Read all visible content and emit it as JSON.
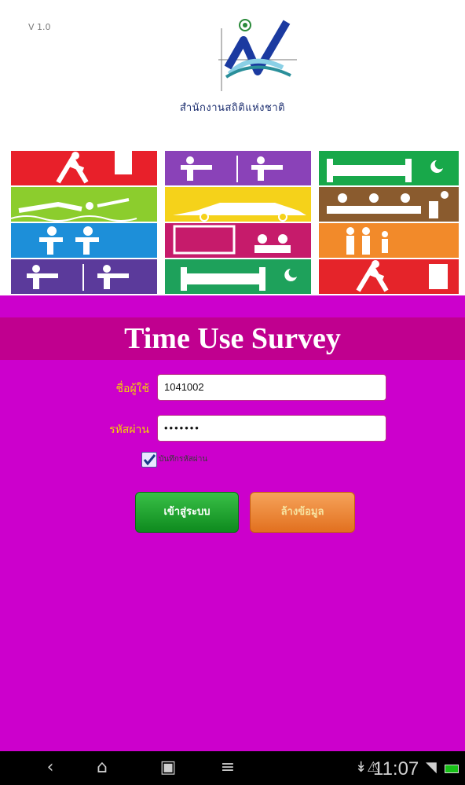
{
  "header": {
    "version": "V 1.0",
    "organization": "สำนักงานสถิติแห่งชาติ"
  },
  "colors": {
    "background_main": "#cc00cc",
    "title_bar": "#c0008f",
    "label_text": "#f4d400",
    "login_button": "#1aa02c",
    "clear_button": "#ef8a35"
  },
  "tiles": [
    {
      "name": "sports-walk-tile",
      "color": "#e8202a",
      "icon": "walking-figure-icon"
    },
    {
      "name": "work-desk-tile",
      "color": "#8a42b8",
      "icon": "desk-worker-icon"
    },
    {
      "name": "sleep-tile",
      "color": "#18a84a",
      "icon": "bed-icon"
    },
    {
      "name": "swimming-tile",
      "color": "#8ccd2d",
      "icon": "swimming-icon"
    },
    {
      "name": "travel-car-tile",
      "color": "#f5d21a",
      "icon": "car-icon"
    },
    {
      "name": "meeting-tile",
      "color": "#8a5b2e",
      "icon": "meeting-icon"
    },
    {
      "name": "study-tile",
      "color": "#1d8fd9",
      "icon": "study-icon"
    },
    {
      "name": "tv-tile",
      "color": "#c61b6b",
      "icon": "tv-icon"
    },
    {
      "name": "family-tile",
      "color": "#f28a2a",
      "icon": "family-icon"
    },
    {
      "name": "office-tile",
      "color": "#5b3a9b",
      "icon": "desk-worker-icon"
    },
    {
      "name": "rest-tile",
      "color": "#1ea15b",
      "icon": "bed-icon"
    },
    {
      "name": "exercise-tile",
      "color": "#e5242a",
      "icon": "walking-figure-icon"
    }
  ],
  "main": {
    "title": "Time Use Survey",
    "username_label": "ชื่อผู้ใช้",
    "username_value": "1041002",
    "password_label": "รหัสผ่าน",
    "password_value": "•••••••",
    "remember_label": "บันทึกรหัสผ่าน",
    "remember_checked": true,
    "login_button": "เข้าสู่ระบบ",
    "clear_button": "ล้างข้อมูล"
  },
  "navbar": {
    "clock": "11:07",
    "back_icon": "back-icon",
    "home_icon": "home-icon",
    "recent_icon": "recent-apps-icon",
    "menu_icon": "menu-icon"
  }
}
